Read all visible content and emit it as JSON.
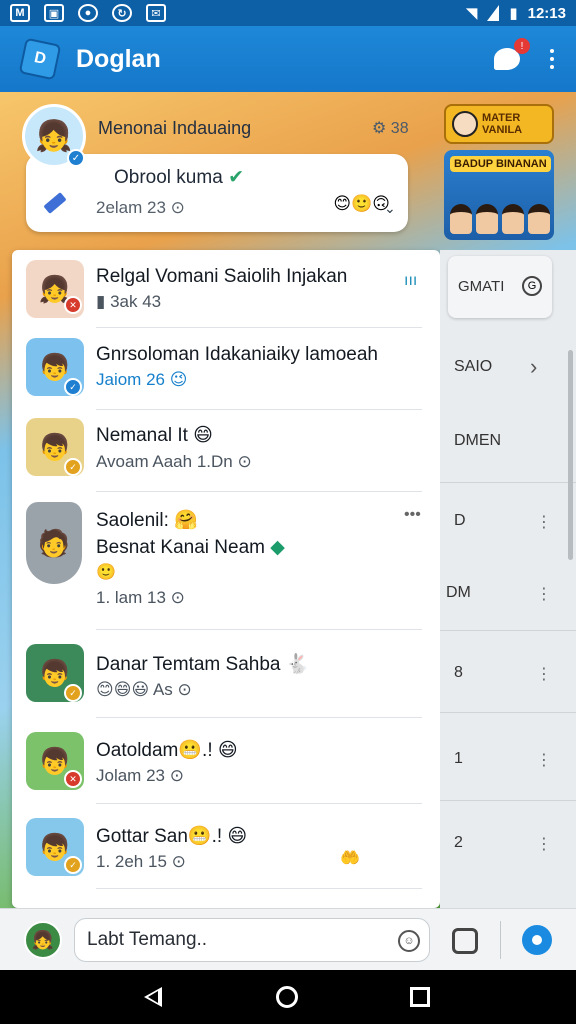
{
  "status_bar": {
    "time": "12:13",
    "icons": [
      "mail-icon",
      "photo-icon",
      "location-icon",
      "sync-icon",
      "message-icon"
    ]
  },
  "app_bar": {
    "title": "Doglan",
    "notification_count": "!"
  },
  "pinned": {
    "name": "Menonai Indauaing",
    "settings_text": "38",
    "message": "Obrool kuma",
    "time": "2elam 23"
  },
  "promos": [
    {
      "text": "MATER VANILA"
    },
    {
      "text": "BADUP BINANAN"
    }
  ],
  "chats": [
    {
      "name": "Relgal Vomani Saiolih Injakan",
      "sub": "3ak 43",
      "side": "GMATI"
    },
    {
      "name": "Gnrsoloman Idakaniaiky lamoeah",
      "sub": "Jaiom 26",
      "side": "SAIO"
    },
    {
      "name": "Nemanal It",
      "sub": "Avoam Aaah 1.Dn",
      "side": "DMEN"
    },
    {
      "name": "Saolenil:",
      "name2": "Besnat Kanai Neam",
      "sub": "1. lam 13",
      "side": "D"
    },
    {
      "name": "Danar Temtam Sahba",
      "sub": "As",
      "side": "DM"
    },
    {
      "name": "Oatoldam",
      "sub": "Jolam 23",
      "side": "8"
    },
    {
      "name": "Gottar San",
      "sub": "1. 2eh 15",
      "side": "1"
    }
  ],
  "side_extra": "2",
  "composer": {
    "placeholder": "Labt Temang.."
  },
  "colors": {
    "app_bar": "#1677c9",
    "status_bar": "#0d5fa6",
    "accent": "#1a8be0"
  }
}
